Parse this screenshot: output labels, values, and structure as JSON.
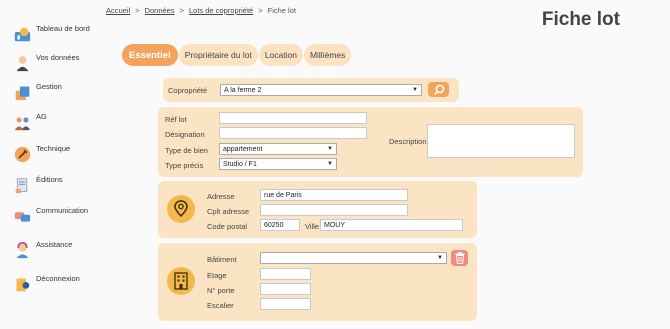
{
  "sidebar": {
    "items": [
      {
        "label": "Tableau de bord",
        "icon": "dashboard-icon"
      },
      {
        "label": "Vos données",
        "icon": "user-icon"
      },
      {
        "label": "Gestion",
        "icon": "management-icon"
      },
      {
        "label": "AG",
        "icon": "meeting-icon"
      },
      {
        "label": "Technique",
        "icon": "tools-icon"
      },
      {
        "label": "Éditions",
        "icon": "documents-icon"
      },
      {
        "label": "Communication",
        "icon": "chat-icon"
      },
      {
        "label": "Assistance",
        "icon": "support-icon"
      },
      {
        "label": "Déconnexion",
        "icon": "logout-icon"
      }
    ]
  },
  "breadcrumb": {
    "items": [
      "Accueil",
      "Données",
      "Lots de copropriété"
    ],
    "current": "Fiche lot",
    "separator": ">"
  },
  "page_title": "Fiche lot",
  "tabs": [
    "Essentiel",
    "Propriétaire du lot",
    "Location",
    "Millièmes"
  ],
  "copro": {
    "label": "Copropriété",
    "selected": "A la ferme 2",
    "search_icon": "search-icon"
  },
  "lot": {
    "ref_label": "Réf lot",
    "ref_value": "",
    "designation_label": "Désignation",
    "designation_value": "",
    "type_bien_label": "Type de bien",
    "type_bien_value": "appartement",
    "type_precis_label": "Type précis",
    "type_precis_value": "Studio / F1",
    "description_label": "Description",
    "description_value": ""
  },
  "address": {
    "icon": "location-pin-icon",
    "adresse_label": "Adresse",
    "adresse_value": "rue de Paris",
    "cplt_label": "Cplt adresse",
    "cplt_value": "",
    "cp_label": "Code postal",
    "cp_value": "60250",
    "ville_label": "Ville",
    "ville_value": "MOUY"
  },
  "building": {
    "icon": "building-icon",
    "batiment_label": "Bâtiment",
    "batiment_value": "",
    "etage_label": "Etage",
    "etage_value": "",
    "porte_label": "N° porte",
    "porte_value": "",
    "escalier_label": "Escalier",
    "escalier_value": "",
    "delete_icon": "trash-icon"
  },
  "colors": {
    "accent": "#f5a25c",
    "panel": "#fbe4c3",
    "tab": "#fbe3c2",
    "icon_circle": "#f2b84a",
    "danger": "#f08a80"
  }
}
